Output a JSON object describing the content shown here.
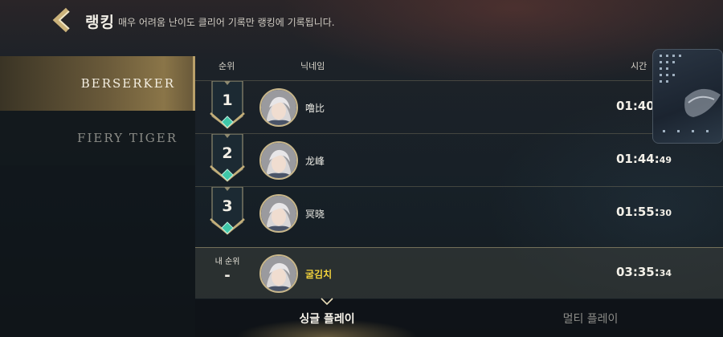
{
  "header": {
    "title": "랭킹",
    "subtitle": "매우 어려움 난이도 클리어 기록만 랭킹에 기록됩니다."
  },
  "sidebar": {
    "items": [
      {
        "label": "BERSERKER",
        "active": true
      },
      {
        "label": "FIERY TIGER",
        "active": false
      }
    ]
  },
  "table": {
    "headers": {
      "rank": "순위",
      "nickname": "닉네임",
      "time": "시간"
    },
    "rows": [
      {
        "rank": "1",
        "nickname": "噜比",
        "time_main": "01:40:",
        "time_ms": ""
      },
      {
        "rank": "2",
        "nickname": "龙峰",
        "time_main": "01:44:",
        "time_ms": "49"
      },
      {
        "rank": "3",
        "nickname": "冥晓",
        "time_main": "01:55:",
        "time_ms": "30"
      }
    ],
    "mine": {
      "label": "내 순위",
      "rank": "-",
      "nickname": "굴김치",
      "time_main": "03:35:",
      "time_ms": "34"
    }
  },
  "tabs": [
    {
      "label": "싱글 플레이",
      "active": true
    },
    {
      "label": "멀티 플레이",
      "active": false
    }
  ],
  "colors": {
    "accent_gold": "#b9a06a",
    "teal_gem": "#3fc7a8",
    "my_name": "#f2d23c"
  }
}
